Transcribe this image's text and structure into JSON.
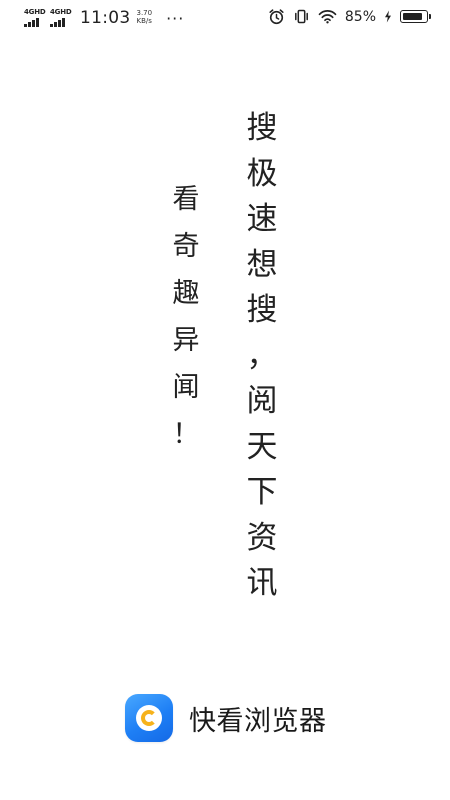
{
  "status_bar": {
    "network_1": "4GHD",
    "network_2": "4GHD",
    "time": "11:03",
    "speed_value": "3.70",
    "speed_unit": "KB/s",
    "more": "···",
    "battery_percent": "85%",
    "battery_level": 0.85,
    "icons": [
      "alarm-icon",
      "vibrate-icon",
      "wifi-icon",
      "charging-icon",
      "battery-icon"
    ]
  },
  "slogan_main": [
    "搜",
    "极",
    "速",
    "想",
    "搜",
    "，",
    "阅",
    "天",
    "下",
    "资",
    "讯"
  ],
  "slogan_sub": [
    "看",
    "奇",
    "趣",
    "异",
    "闻",
    "！"
  ],
  "brand": {
    "name": "快看浏览器",
    "logo_icon": "kuaikan-browser-logo",
    "colors": {
      "logo_blue": "#1e7ff5",
      "logo_ring": "#f6b21b"
    }
  }
}
